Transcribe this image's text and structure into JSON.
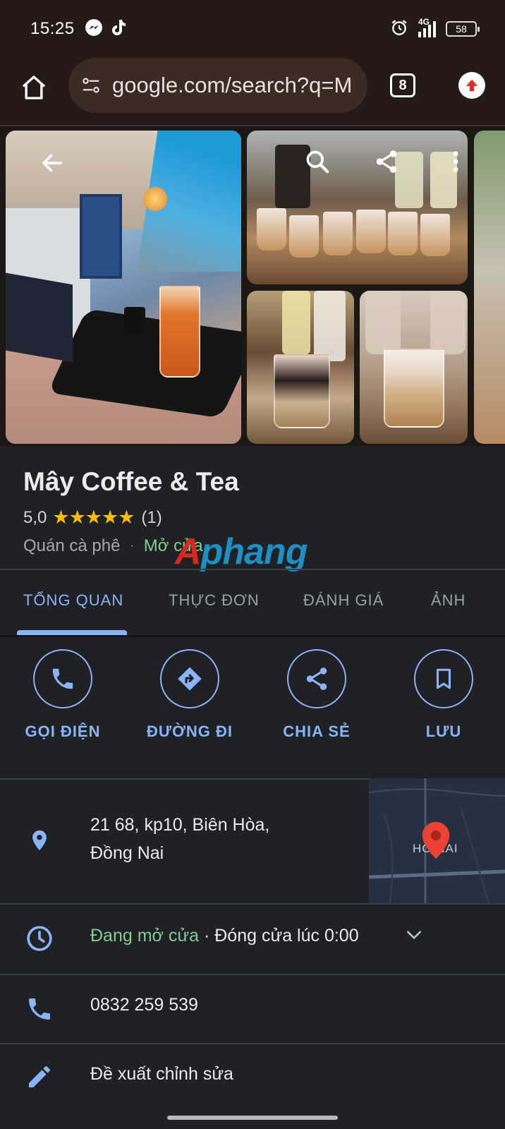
{
  "status_bar": {
    "time": "15:25",
    "network": "4G",
    "battery": "58"
  },
  "browser": {
    "url": "google.com/search?q=M",
    "tab_count": "8"
  },
  "place": {
    "name": "Mây Coffee & Tea",
    "rating": "5,0",
    "stars": "★★★★★",
    "review_count": "(1)",
    "category": "Quán cà phê",
    "separator": "·",
    "open_status": "Mở cửa"
  },
  "watermark": {
    "part1": "A",
    "part2": "phang"
  },
  "tabs": [
    {
      "label": "TỔNG QUAN",
      "active": true
    },
    {
      "label": "THỰC ĐƠN",
      "active": false
    },
    {
      "label": "ĐÁNH GIÁ",
      "active": false
    },
    {
      "label": "ẢNH",
      "active": false
    }
  ],
  "actions": [
    {
      "label": "GỌI ĐIỆN",
      "icon": "phone-icon"
    },
    {
      "label": "ĐƯỜNG ĐI",
      "icon": "directions-icon"
    },
    {
      "label": "CHIA SẺ",
      "icon": "share-icon"
    },
    {
      "label": "LƯU",
      "icon": "bookmark-icon"
    }
  ],
  "info": {
    "address_line1": "21 68, kp10, Biên Hòa,",
    "address_line2": "Đồng Nai",
    "map_label": "HỒ NAI",
    "hours_open": "Đang mở cửa",
    "hours_separator": " · ",
    "hours_close": "Đóng cửa lúc 0:00",
    "phone": "0832 259 539",
    "suggest_edit": "Đề xuất chỉnh sửa"
  },
  "colors": {
    "accent": "#8ab4f8",
    "open_green": "#7fcf91",
    "star": "#fbbc04",
    "map_pin": "#ea4335",
    "background": "#202124",
    "browser_bar": "#261a16"
  }
}
